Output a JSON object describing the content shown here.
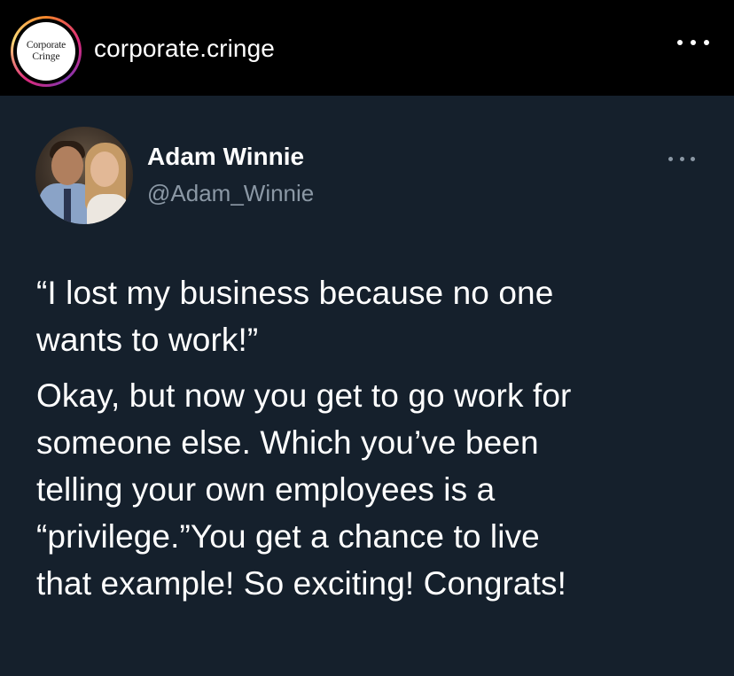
{
  "post_header": {
    "avatar_text_line1": "Corporate",
    "avatar_text_line2": "Cringe",
    "username": "corporate.cringe",
    "more_icon": "more-horizontal-icon"
  },
  "tweet": {
    "display_name": "Adam Winnie",
    "handle": "@Adam_Winnie",
    "more_icon": "more-horizontal-icon",
    "paragraph1_lines": [
      "“I lost my business because no one",
      "wants to work!”"
    ],
    "paragraph2_lines": [
      "Okay, but now you get to go work for",
      "someone else. Which you’ve been",
      "telling your own employees is a",
      "“privilege.”You get a chance to live",
      "that example! So exciting! Congrats!"
    ]
  },
  "colors": {
    "page_background": "#000000",
    "tweet_background": "#15202c",
    "primary_text": "#ffffff",
    "secondary_text": "#8b98a5"
  }
}
